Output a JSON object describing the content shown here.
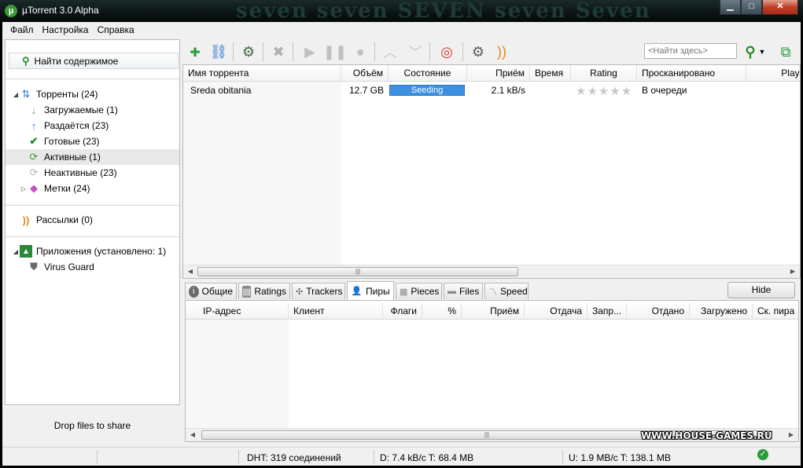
{
  "window": {
    "title": "µTorrent 3.0 Alpha",
    "decor_text": "seven  seven  SEVEN  seven  Seven"
  },
  "menu": [
    "Файл",
    "Настройка",
    "Справка"
  ],
  "sidebar": {
    "find_button": "Найти содержимое",
    "torrents": {
      "label": "Торренты (24)",
      "children": [
        {
          "label": "Загружаемые (1)"
        },
        {
          "label": "Раздаётся (23)"
        },
        {
          "label": "Готовые (23)"
        },
        {
          "label": "Активные (1)"
        },
        {
          "label": "Неактивные (23)"
        },
        {
          "label": "Метки (24)"
        }
      ]
    },
    "feeds": "Рассылки (0)",
    "apps": {
      "label": "Приложения (установлено: 1)",
      "children": [
        {
          "label": "Virus Guard"
        }
      ]
    },
    "drop_text": "Drop files to share"
  },
  "toolbar": {
    "search_placeholder": "<Найти здесь>"
  },
  "torrent_list": {
    "columns": [
      "Имя торрента",
      "Объём",
      "Состояние",
      "Приём",
      "Время",
      "Rating",
      "Просканировано",
      "Playback"
    ],
    "rows": [
      {
        "name": "Sreda obitania",
        "size": "12.7 GB",
        "status": "Seeding",
        "down": "2.1 kB/s",
        "time": "",
        "rating_stars": 0,
        "scanned": "В очереди",
        "playback": ""
      }
    ]
  },
  "tabs": [
    {
      "label": "Общие",
      "icon": "info-icon"
    },
    {
      "label": "Ratings",
      "icon": "ratings-icon"
    },
    {
      "label": "Trackers",
      "icon": "trackers-icon"
    },
    {
      "label": "Пиры",
      "icon": "peers-icon"
    },
    {
      "label": "Pieces",
      "icon": "pieces-icon"
    },
    {
      "label": "Files",
      "icon": "files-icon"
    },
    {
      "label": "Speed",
      "icon": "speed-icon"
    }
  ],
  "hide_button": "Hide",
  "peers_table": {
    "columns": [
      "IP-адрес",
      "Клиент",
      "Флаги",
      "%",
      "Приём",
      "Отдача",
      "Запр...",
      "Отдано",
      "Загружено",
      "Ск. пира"
    ]
  },
  "statusbar": {
    "dht": "DHT: 319 соединений",
    "down": "D: 7.4 kB/c T: 68.4 MB",
    "up": "U: 1.9 MB/c T: 138.1 MB"
  },
  "watermark": "WWW.HOUSE-GAMES.RU"
}
